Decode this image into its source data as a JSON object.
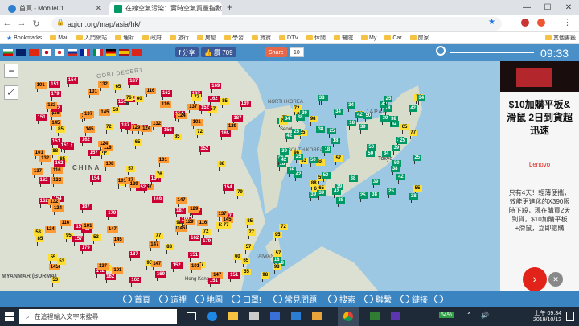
{
  "browser": {
    "tabs": [
      {
        "title": "首頁 - Mobile01",
        "active": false
      },
      {
        "title": "在線空氣污染：實時空氣質量指數...",
        "active": true
      }
    ],
    "new_tab_label": "+",
    "url": "aqicn.org/map/asia/hk/",
    "bookmarks": [
      {
        "label": "Bookmarks"
      },
      {
        "label": "Mail"
      },
      {
        "label": "入門網站"
      },
      {
        "label": "理財"
      },
      {
        "label": "政府"
      },
      {
        "label": "旅行"
      },
      {
        "label": "房屋"
      },
      {
        "label": "學習"
      },
      {
        "label": "寶寶"
      },
      {
        "label": "DTV"
      },
      {
        "label": "休閒"
      },
      {
        "label": "醫院"
      },
      {
        "label": "My"
      },
      {
        "label": "Car"
      },
      {
        "label": "房家"
      },
      {
        "label": "其他書籤"
      }
    ]
  },
  "site": {
    "share_label": "分享",
    "like_label": "讚 709",
    "share_button_label": "Share",
    "share_count": "10",
    "clock": "09:33",
    "zoom_out": "−",
    "map_labels": {
      "gobi": "GOBI DESERT",
      "china": "CHINA",
      "myanmar": "MYANMAR (BURMA)",
      "north_korea": "NORTH KOREA",
      "south_korea": "SOUTH KOREA",
      "tokyo": "Tokyo",
      "japan": "JAPAN",
      "taiwan": "TAIWAN",
      "hong_kong": "Hong Kong",
      "seoul": "Seoul"
    },
    "nav": [
      {
        "label": "首頁",
        "icon": "home-icon"
      },
      {
        "label": "這裡",
        "icon": "pin-icon"
      },
      {
        "label": "地圖",
        "icon": "map-icon"
      },
      {
        "label": "口罩!",
        "icon": "mask-icon"
      },
      {
        "label": "常見問題",
        "icon": "faq-icon"
      },
      {
        "label": "搜索",
        "icon": "search-icon"
      },
      {
        "label": "聯繫",
        "icon": "contact-icon"
      },
      {
        "label": "鏈接",
        "icon": "link-icon"
      }
    ]
  },
  "ad": {
    "headline": "$10加購平板&滑鼠 2日到貨超迅速",
    "brand": "Lenovo",
    "body": "只有4天！輕薄便攜，效能更進化的X390限時下殺，現在購買2天到貨，$10加購平板+滑鼠，立即搶購"
  },
  "taskbar": {
    "search_placeholder": "在這裡輸入文字來搜尋",
    "battery": "54%",
    "time": "上午 09:34",
    "date": "2019/10/12"
  },
  "colors": {
    "good": "#009966",
    "moderate": "#ffde33",
    "usg": "#ff9933",
    "unhealthy": "#cc0033",
    "very_unhealthy": "#660099"
  },
  "markers": [
    {
      "v": "39",
      "c": "good"
    },
    {
      "v": "18",
      "c": "good"
    },
    {
      "v": "79",
      "c": "moderate"
    },
    {
      "v": "98",
      "c": "moderate"
    },
    {
      "v": "124",
      "c": "usg"
    },
    {
      "v": "151",
      "c": "unhealthy"
    },
    {
      "v": "154",
      "c": "unhealthy"
    },
    {
      "v": "152",
      "c": "unhealthy"
    },
    {
      "v": "162",
      "c": "unhealthy"
    },
    {
      "v": "187",
      "c": "unhealthy"
    },
    {
      "v": "192",
      "c": "unhealthy"
    },
    {
      "v": "65",
      "c": "moderate"
    },
    {
      "v": "72",
      "c": "moderate"
    },
    {
      "v": "25",
      "c": "good"
    },
    {
      "v": "95",
      "c": "moderate"
    },
    {
      "v": "300",
      "c": "very_unhealthy"
    },
    {
      "v": "108",
      "c": "usg"
    },
    {
      "v": "137",
      "c": "usg"
    },
    {
      "v": "145",
      "c": "usg"
    },
    {
      "v": "53",
      "c": "moderate"
    },
    {
      "v": "55",
      "c": "moderate"
    },
    {
      "v": "85",
      "c": "moderate"
    },
    {
      "v": "60",
      "c": "moderate"
    },
    {
      "v": "77",
      "c": "moderate"
    },
    {
      "v": "157",
      "c": "unhealthy"
    },
    {
      "v": "132",
      "c": "usg"
    },
    {
      "v": "116",
      "c": "usg"
    },
    {
      "v": "34",
      "c": "good"
    },
    {
      "v": "50",
      "c": "good"
    },
    {
      "v": "38",
      "c": "good"
    },
    {
      "v": "42",
      "c": "good"
    },
    {
      "v": "57",
      "c": "moderate"
    },
    {
      "v": "76",
      "c": "moderate"
    },
    {
      "v": "147",
      "c": "usg"
    },
    {
      "v": "129",
      "c": "usg"
    },
    {
      "v": "169",
      "c": "unhealthy"
    },
    {
      "v": "179",
      "c": "unhealthy"
    },
    {
      "v": "156",
      "c": "unhealthy"
    },
    {
      "v": "88",
      "c": "moderate"
    },
    {
      "v": "101",
      "c": "usg"
    }
  ]
}
